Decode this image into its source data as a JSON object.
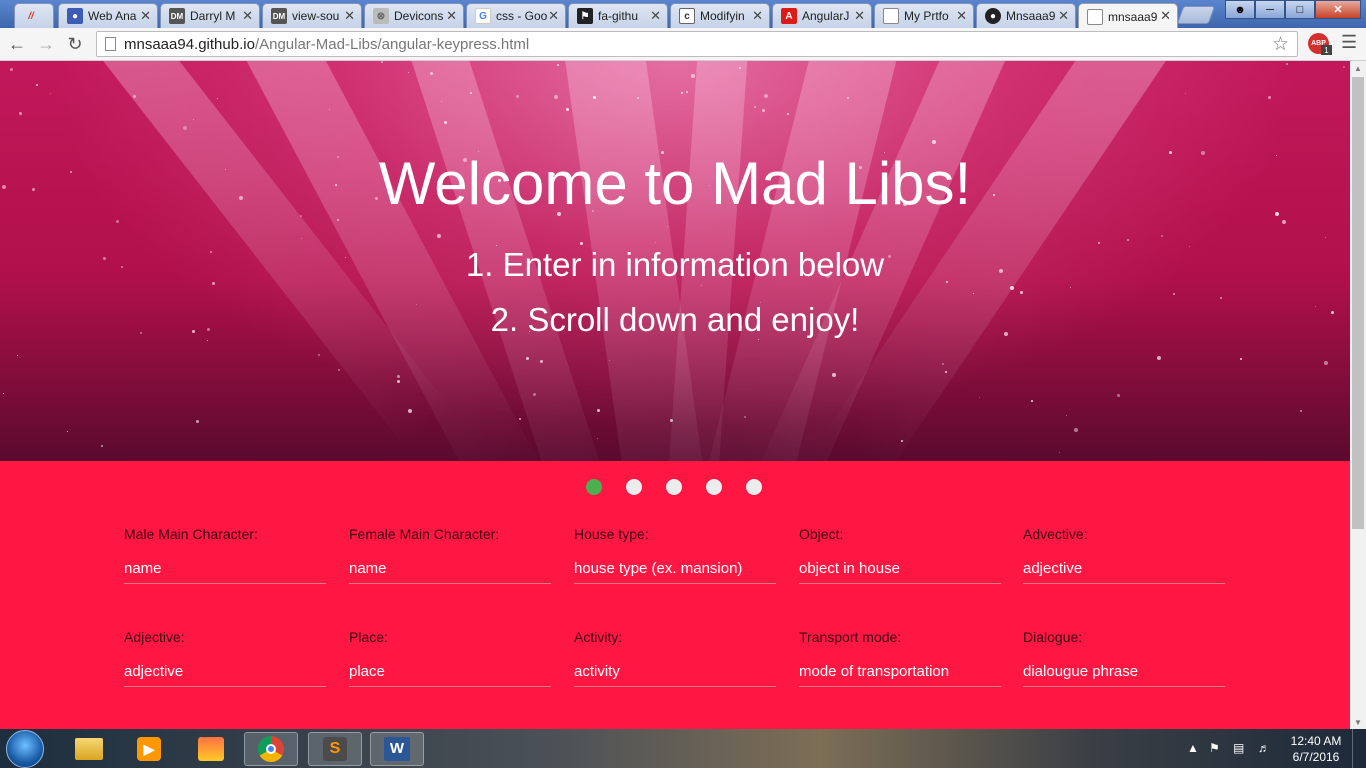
{
  "browser": {
    "tabs": [
      {
        "label": "Web Ana",
        "icon": "person-icon",
        "color": "#3b5bb5"
      },
      {
        "label": "Darryl M",
        "icon": "dm-icon",
        "color": "#555"
      },
      {
        "label": "view-sou",
        "icon": "dm-icon",
        "color": "#555"
      },
      {
        "label": "Devicons",
        "icon": "devicon-icon",
        "color": "#999"
      },
      {
        "label": "css - Goo",
        "icon": "google-icon",
        "color": "#4285f4"
      },
      {
        "label": "fa-githu",
        "icon": "flag-icon",
        "color": "#222"
      },
      {
        "label": "Modifyin",
        "icon": "codepen-icon",
        "color": "#444"
      },
      {
        "label": "AngularJ",
        "icon": "angular-icon",
        "color": "#dd1b16"
      },
      {
        "label": "My Prtfo",
        "icon": "page-icon",
        "color": "#888"
      },
      {
        "label": "Mnsaaa9",
        "icon": "github-icon",
        "color": "#222"
      },
      {
        "label": "mnsaaa9",
        "icon": "page-icon",
        "color": "#888"
      }
    ],
    "url_host": "mnsaaa94.github.io",
    "url_path": "/Angular-Mad-Libs/angular-keypress.html",
    "abp_label": "ABP",
    "abp_count": "1"
  },
  "hero": {
    "title": "Welcome to Mad Libs!",
    "step1": "1. Enter in information below",
    "step2": "2. Scroll down and enjoy!"
  },
  "pagination": {
    "count": 5,
    "active_index": 0,
    "active_color": "#4caf50"
  },
  "form": {
    "row1": [
      {
        "label": "Male Main Character:",
        "placeholder": "name"
      },
      {
        "label": "Female Main Character:",
        "placeholder": "name"
      },
      {
        "label": "House type:",
        "placeholder": "house type (ex. mansion)"
      },
      {
        "label": "Object:",
        "placeholder": "object in house"
      },
      {
        "label": "Advective:",
        "placeholder": "adjective"
      }
    ],
    "row2": [
      {
        "label": "Adjective:",
        "placeholder": "adjective"
      },
      {
        "label": "Place:",
        "placeholder": "place"
      },
      {
        "label": "Activity:",
        "placeholder": "activity"
      },
      {
        "label": "Transport mode:",
        "placeholder": "mode of transportation"
      },
      {
        "label": "Dialogue:",
        "placeholder": "dialougue phrase"
      }
    ]
  },
  "colors": {
    "form_bg": "#ff1744",
    "hero_base": "#c2185b"
  },
  "taskbar": {
    "apps": [
      "internet-explorer-icon",
      "file-explorer-icon",
      "media-player-icon",
      "paint-icon",
      "chrome-icon",
      "sublime-text-icon",
      "word-icon"
    ],
    "time": "12:40 AM",
    "date": "6/7/2016"
  }
}
